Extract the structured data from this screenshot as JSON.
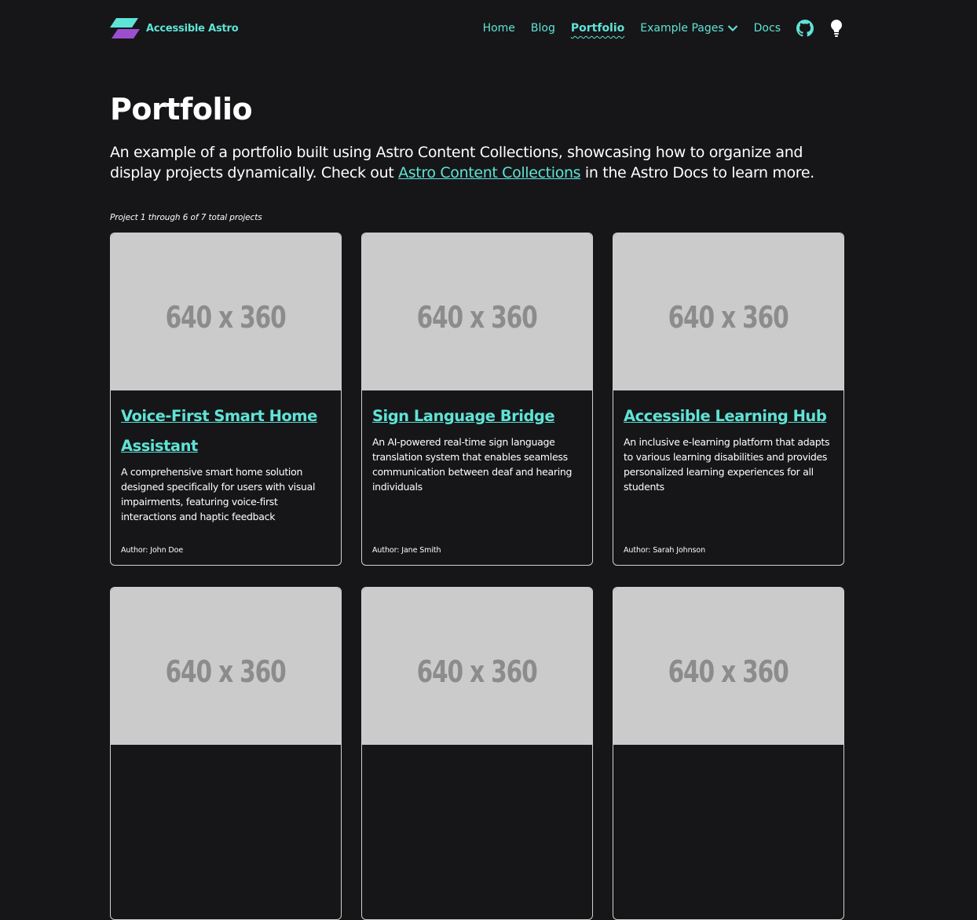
{
  "header": {
    "brand": "Accessible Astro",
    "nav": [
      {
        "label": "Home"
      },
      {
        "label": "Blog"
      },
      {
        "label": "Portfolio"
      },
      {
        "label": "Example Pages"
      },
      {
        "label": "Docs"
      }
    ],
    "icons": [
      "github-icon",
      "lightbulb-icon"
    ],
    "current": "Portfolio"
  },
  "page": {
    "title": "Portfolio",
    "intro_before": "An example of a portfolio built using Astro Content Collections, showcasing how to organize and display projects dynamically. Check out ",
    "intro_link": "Astro Content Collections",
    "intro_after": " in the Astro Docs to learn more.",
    "count": "Project 1 through 6 of 7 total projects"
  },
  "projects": [
    {
      "image_text": "640 x 360",
      "title": "Voice-First Smart Home Assistant",
      "description": "A comprehensive smart home solution designed specifically for users with visual impairments, featuring voice-first interactions and haptic feedback",
      "author": "Author: John Doe"
    },
    {
      "image_text": "640 x 360",
      "title": "Sign Language Bridge",
      "description": "An AI-powered real-time sign language translation system that enables seamless communication between deaf and hearing individuals",
      "author": "Author: Jane Smith"
    },
    {
      "image_text": "640 x 360",
      "title": "Accessible Learning Hub",
      "description": "An inclusive e-learning platform that adapts to various learning disabilities and provides personalized learning experiences for all students",
      "author": "Author: Sarah Johnson"
    },
    {
      "image_text": "640 x 360"
    },
    {
      "image_text": "640 x 360"
    },
    {
      "image_text": "640 x 360"
    }
  ],
  "colors": {
    "background": "#161618",
    "accent": "#5fe3d6",
    "logo_purple": "#9b4fd0",
    "placeholder_bg": "#cbcbcb",
    "placeholder_text": "#8c8c8c"
  }
}
